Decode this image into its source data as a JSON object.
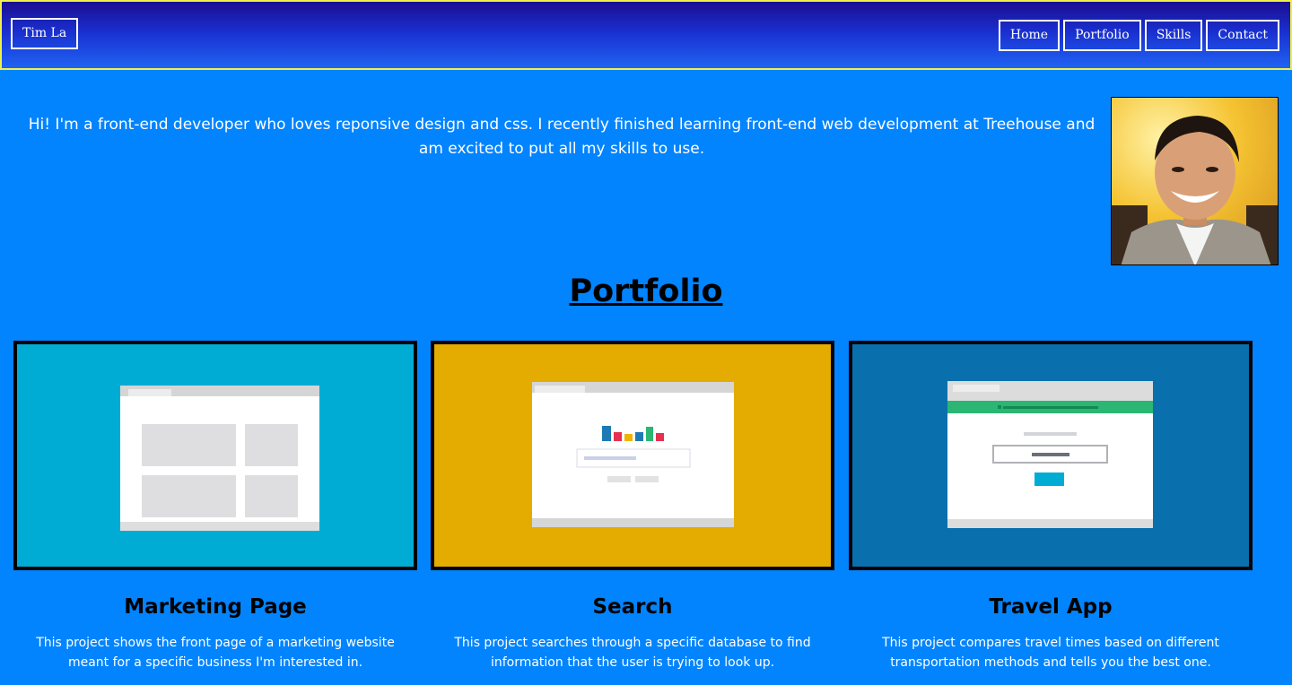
{
  "header": {
    "brand": "Tim La",
    "nav": [
      "Home",
      "Portfolio",
      "Skills",
      "Contact"
    ]
  },
  "intro": {
    "text": "Hi! I'm a front-end developer who loves reponsive design and css. I recently finished learning front-end web development at Treehouse and am excited to put all my skills to use."
  },
  "portfolio": {
    "title": "Portfolio",
    "projects": [
      {
        "title": "Marketing Page",
        "description": "This project shows the front page of a marketing website meant for a specific business I'm interested in.",
        "thumb_color": "#00acd4"
      },
      {
        "title": "Search",
        "description": "This project searches through a specific database to find information that the user is trying to look up.",
        "thumb_color": "#e4ab00"
      },
      {
        "title": "Travel App",
        "description": "This project compares travel times based on different transportation methods and tells you the best one.",
        "thumb_color": "#0970ad"
      }
    ]
  },
  "colors": {
    "page_bg": "#0284fe",
    "header_border": "#f0f04a"
  }
}
